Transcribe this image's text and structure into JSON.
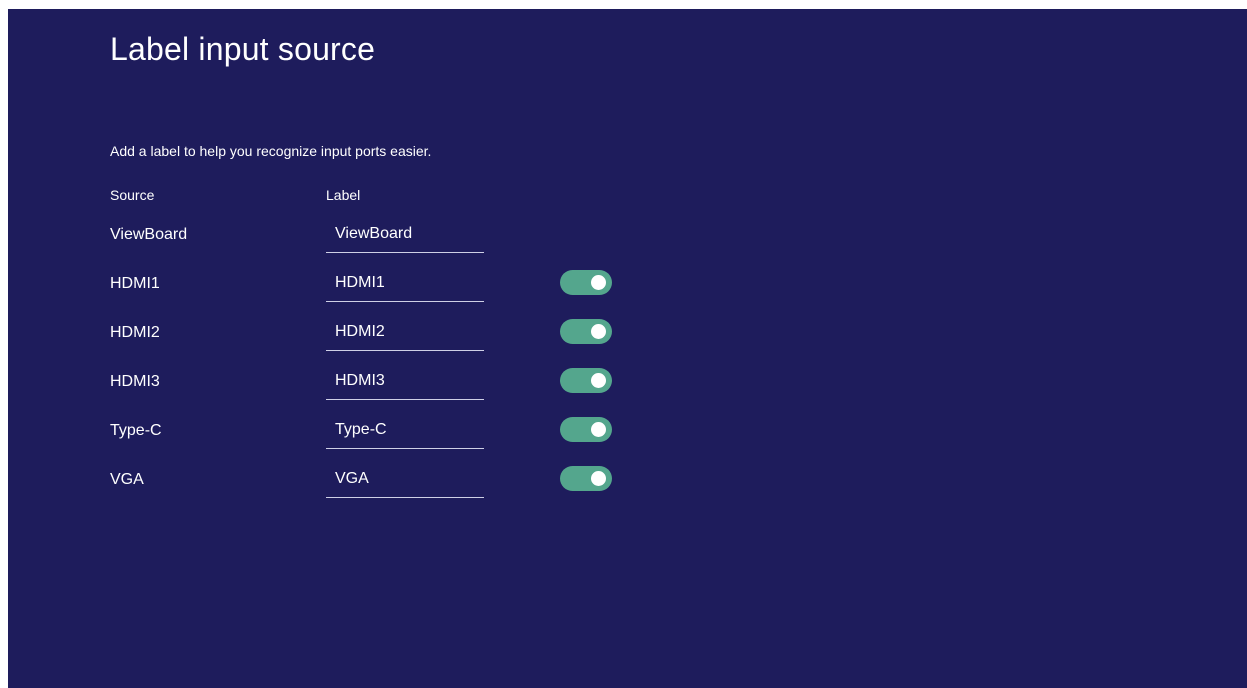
{
  "page": {
    "title": "Label input source",
    "description": "Add a label to help you recognize input ports easier."
  },
  "table": {
    "source_header": "Source",
    "label_header": "Label",
    "rows": [
      {
        "source": "ViewBoard",
        "label": "ViewBoard",
        "has_toggle": false,
        "enabled": null
      },
      {
        "source": "HDMI1",
        "label": "HDMI1",
        "has_toggle": true,
        "enabled": true
      },
      {
        "source": "HDMI2",
        "label": "HDMI2",
        "has_toggle": true,
        "enabled": true
      },
      {
        "source": "HDMI3",
        "label": "HDMI3",
        "has_toggle": true,
        "enabled": true
      },
      {
        "source": "Type-C",
        "label": "Type-C",
        "has_toggle": true,
        "enabled": true
      },
      {
        "source": "VGA",
        "label": "VGA",
        "has_toggle": true,
        "enabled": true
      }
    ]
  },
  "colors": {
    "background": "#1e1c5c",
    "toggle_on": "#54a68d",
    "text": "#ffffff"
  }
}
